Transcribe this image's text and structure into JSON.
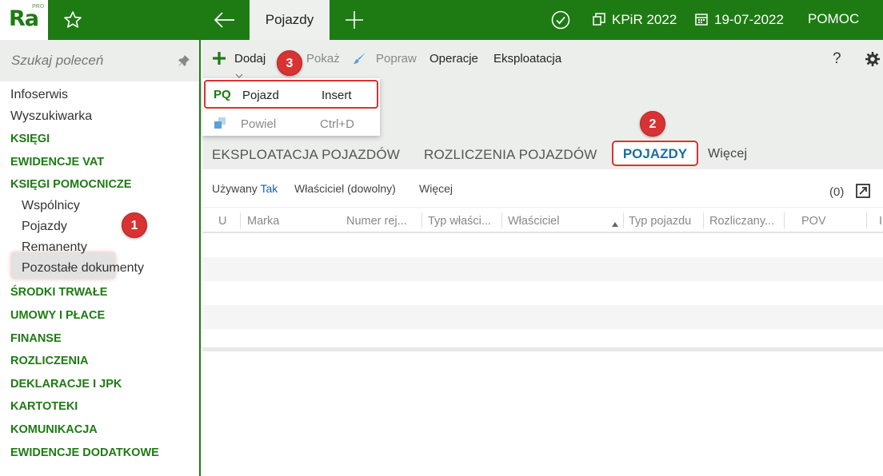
{
  "app": {
    "logo_text": "Ra",
    "logo_badge": "PRO",
    "active_tab": "Pojazdy",
    "ledger": "KPiR 2022",
    "date": "19-07-2022",
    "help": "POMOC"
  },
  "colors": {
    "brand_green": "#1e7b14",
    "toolbar_gray": "#eceeec",
    "highlight_red": "#d93232",
    "link_blue": "#1a6fa0"
  },
  "icons": {
    "favorite": "star-icon",
    "back": "arrow-left-icon",
    "new_tab": "plus-icon",
    "status": "check-circle-icon",
    "ledger": "ledger-icon",
    "date": "calendar-icon",
    "pin": "pin-icon",
    "settings": "gear-icon",
    "expand": "expand-icon"
  },
  "sidebar": {
    "search_placeholder": "Szukaj poleceń",
    "items": {
      "infoserwis": "Infoserwis",
      "wyszukiwarka": "Wyszukiwarka",
      "ksiegi": "KSIĘGI",
      "ewidencje_vat": "EWIDENCJE VAT",
      "ksiegi_pomocnicze": "KSIĘGI POMOCNICZE",
      "wspolnicy": "Wspólnicy",
      "pojazdy": "Pojazdy",
      "remanenty": "Remanenty",
      "pozostale": "Pozostałe dokumenty",
      "srodki_trwale": "ŚRODKI TRWAŁE",
      "umowy_place": "UMOWY I PŁACE",
      "finanse": "FINANSE",
      "rozliczenia": "ROZLICZENIA",
      "deklaracje": "DEKLARACJE I JPK",
      "kartoteki": "KARTOTEKI",
      "komunikacja": "KOMUNIKACJA",
      "ewidencje_dodatkowe": "EWIDENCJE DODATKOWE"
    }
  },
  "toolbar": {
    "add": "Dodaj",
    "show": "Pokaż",
    "edit": "Popraw",
    "operations": "Operacje",
    "exploitation": "Eksploatacja",
    "help": "?"
  },
  "add_menu": {
    "item1_code": "PQ",
    "item1_label": "Pojazd",
    "item1_shortcut": "Insert",
    "item2_label": "Powiel",
    "item2_shortcut": "Ctrl+D"
  },
  "tabs": {
    "exploitation": "EKSPLOATACJA POJAZDÓW",
    "settlements": "ROZLICZENIA POJAZDÓW",
    "vehicles": "POJAZDY",
    "more": "Więcej"
  },
  "filters": {
    "used_label": "Używany",
    "used_value": "Tak",
    "owner": "Właściciel (dowolny)",
    "more": "Więcej",
    "count": "(0)"
  },
  "grid": {
    "columns": {
      "u": "U",
      "make": "Marka",
      "reg_number": "Numer rej...",
      "owner_type": "Typ właści...",
      "owner": "Właściciel",
      "vehicle_type": "Typ pojazdu",
      "settled": "Rozliczany...",
      "pov": "POV",
      "last": "I"
    }
  },
  "badges": {
    "b1": "1",
    "b2": "2",
    "b3": "3"
  }
}
